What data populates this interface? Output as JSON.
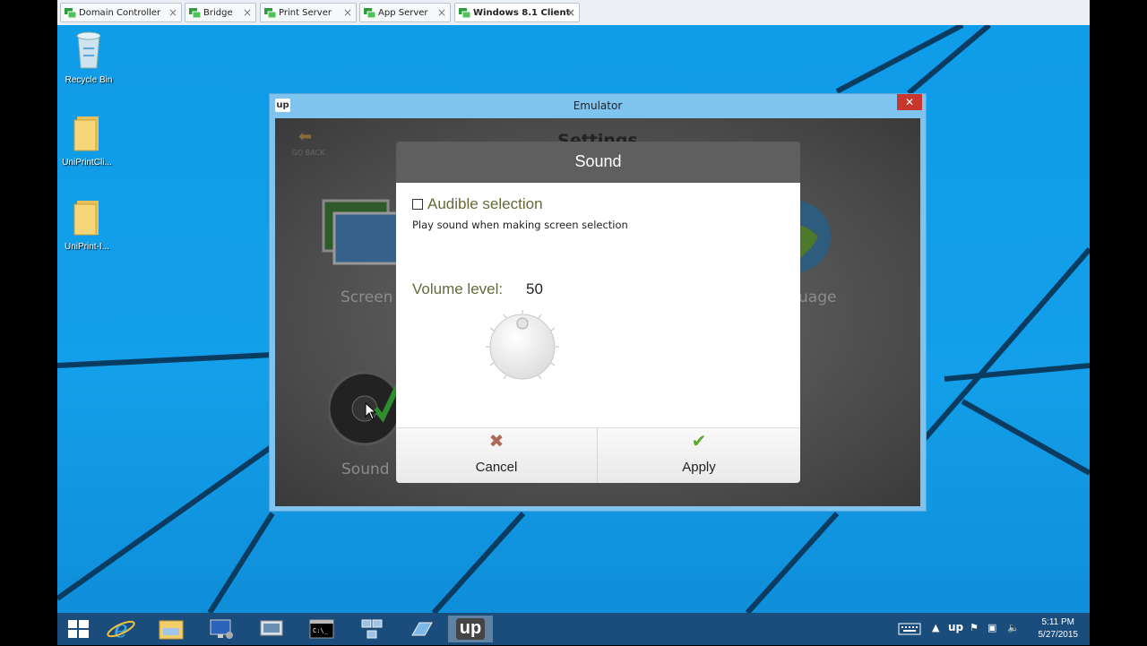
{
  "vm_tabs": [
    {
      "label": "Domain Controller",
      "active": false
    },
    {
      "label": "Bridge",
      "active": false
    },
    {
      "label": "Print Server",
      "active": false
    },
    {
      "label": "App Server",
      "active": false
    },
    {
      "label": "Windows 8.1 Client",
      "active": true
    }
  ],
  "tab_close_glyph": "×",
  "desktop_icons": [
    {
      "label": "Recycle Bin",
      "icon": "recycle-bin-icon"
    },
    {
      "label": "UniPrintCli...",
      "icon": "folder-icon"
    },
    {
      "label": "UniPrint-I...",
      "icon": "folder-icon"
    }
  ],
  "emulator": {
    "title": "Emulator",
    "logo_text": "up",
    "close_glyph": "✕",
    "settings": {
      "title": "Settings",
      "back_label": "GO BACK",
      "tiles": [
        "Screen",
        "uage",
        "Sound"
      ]
    }
  },
  "dialog": {
    "title": "Sound",
    "audible_selection": {
      "label": "Audible selection",
      "checked": false,
      "description": "Play sound when making screen selection"
    },
    "volume": {
      "label": "Volume level:",
      "value": "50",
      "level_fraction": 0.5
    },
    "buttons": {
      "cancel": "Cancel",
      "apply": "Apply"
    }
  },
  "taskbar": {
    "pinned": [
      "windows-start-icon",
      "internet-explorer-icon",
      "file-explorer-icon",
      "server-manager-icon",
      "remote-desktop-icon",
      "command-prompt-icon",
      "network-icon",
      "run-icon",
      "uniprint-up-icon"
    ],
    "active_app_label": "up",
    "tray": {
      "time": "5:11 PM",
      "date": "5/27/2015",
      "up_label": "up"
    }
  },
  "colors": {
    "desktop_blue": "#139fe9",
    "taskbar": "#1a4d7c",
    "dialog_header": "#5f5f5f",
    "accent_text": "#666a3a",
    "apply_green": "#5aa92e",
    "cancel_red": "#b06a5a"
  }
}
